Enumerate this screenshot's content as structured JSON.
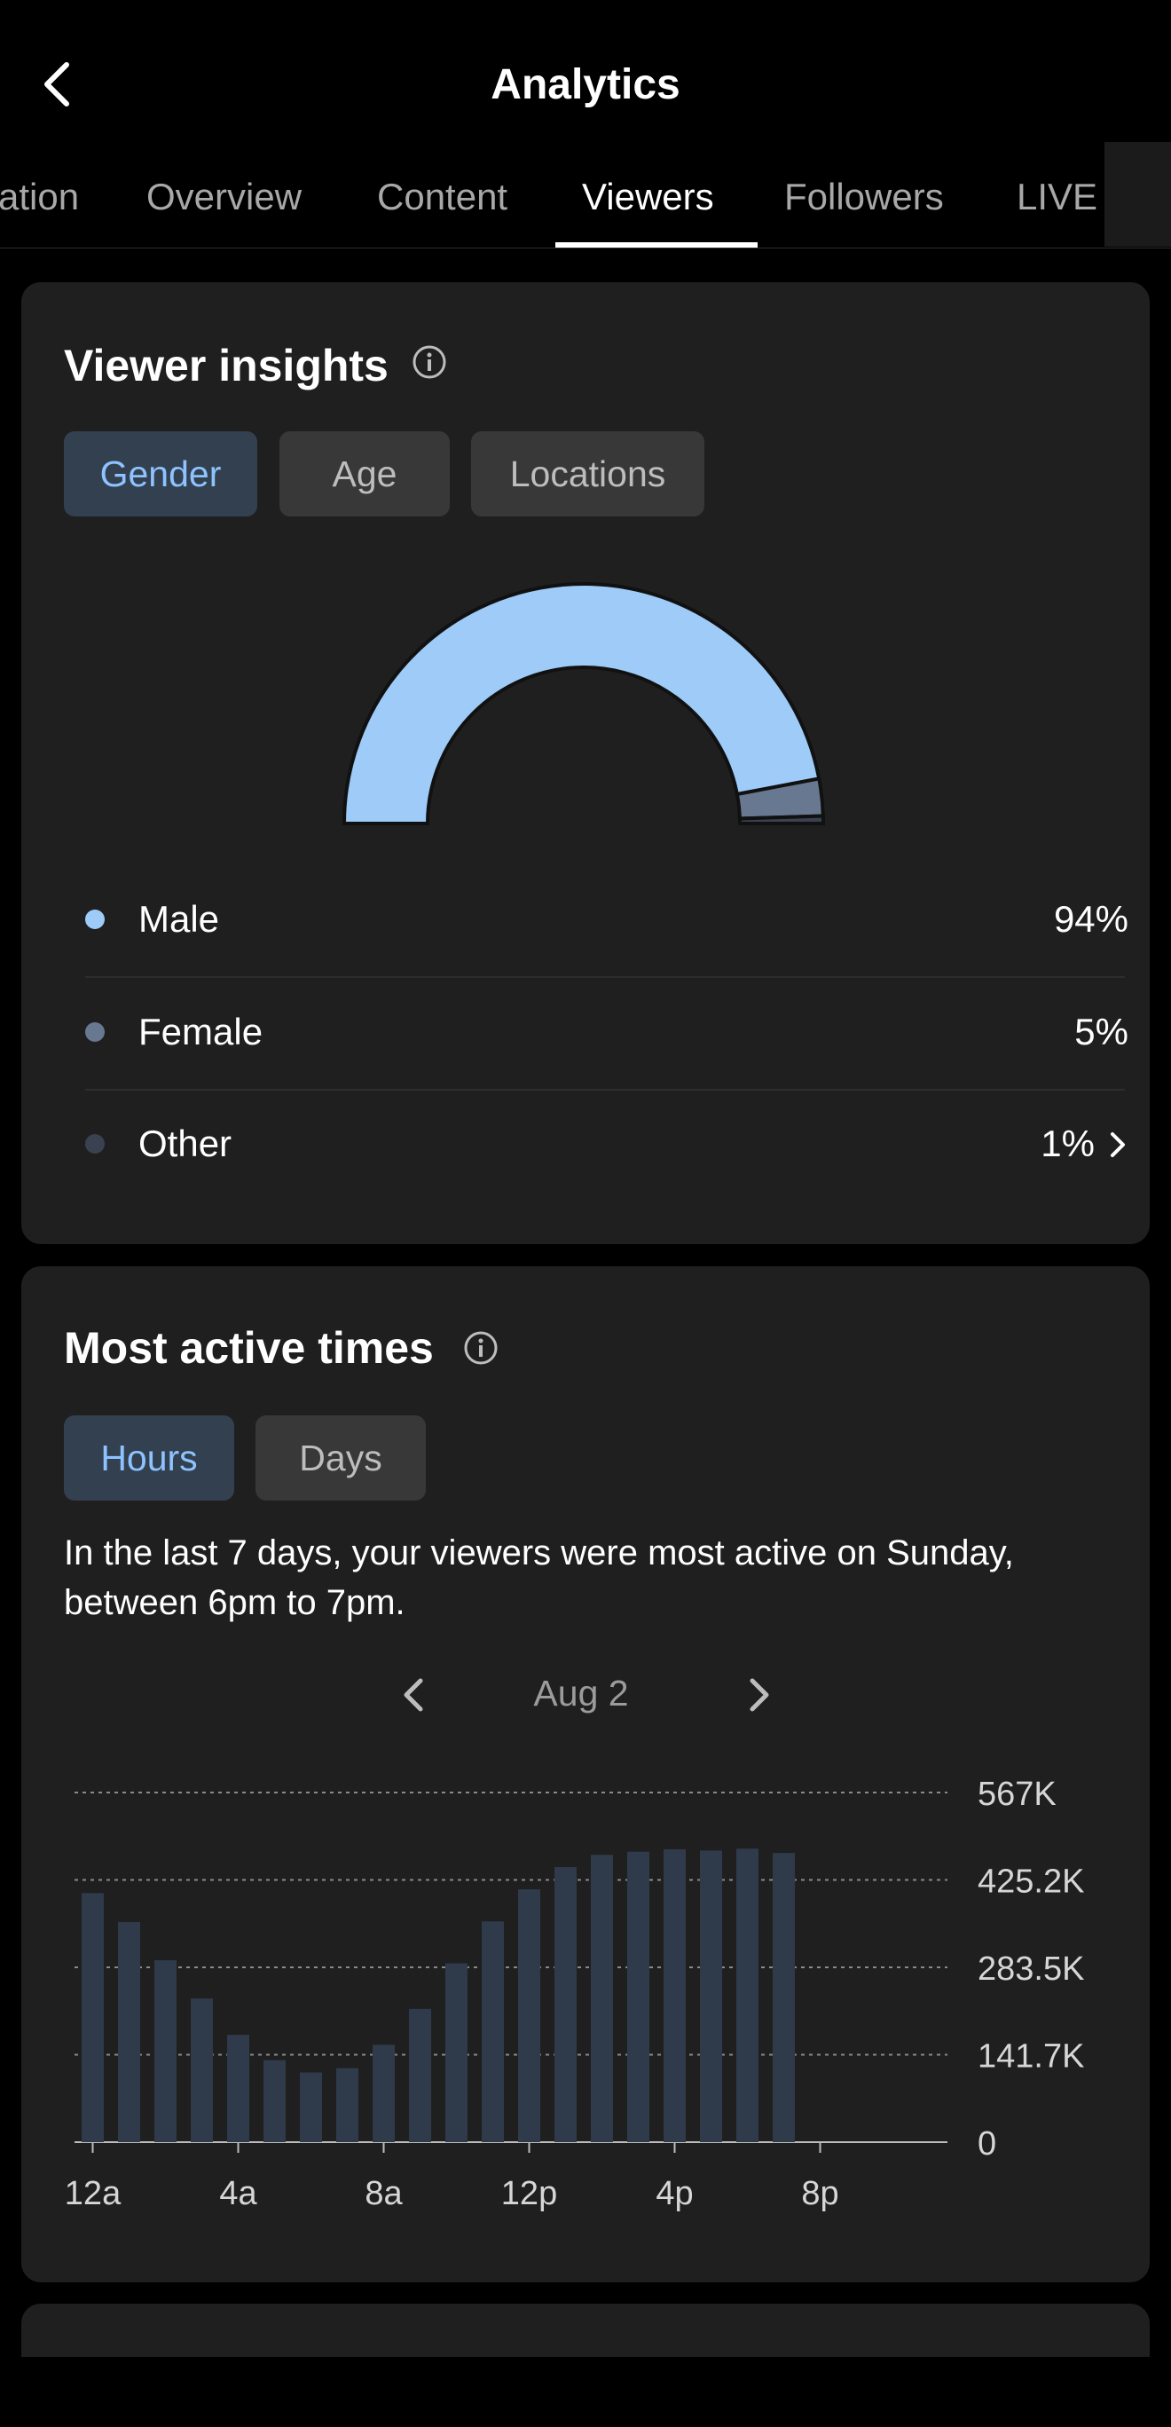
{
  "header": {
    "title": "Analytics"
  },
  "tabs": [
    {
      "label": "ation",
      "active": false
    },
    {
      "label": "Overview",
      "active": false
    },
    {
      "label": "Content",
      "active": false
    },
    {
      "label": "Viewers",
      "active": true
    },
    {
      "label": "Followers",
      "active": false
    },
    {
      "label": "LIVE",
      "active": false
    }
  ],
  "viewer_insights": {
    "title": "Viewer insights",
    "filters": [
      "Gender",
      "Age",
      "Locations"
    ],
    "selected_filter": "Gender",
    "legend": [
      {
        "label": "Male",
        "value": "94%",
        "color": "#9ecbf7"
      },
      {
        "label": "Female",
        "value": "5%",
        "color": "#687891"
      },
      {
        "label": "Other",
        "value": "1%",
        "color": "#3a4150"
      }
    ]
  },
  "active_times": {
    "title": "Most active times",
    "filters": [
      "Hours",
      "Days"
    ],
    "selected_filter": "Hours",
    "description": "In the last 7 days, your viewers were most active on Sunday, between 6pm to 7pm.",
    "date_label": "Aug 2"
  },
  "chart_data": [
    {
      "type": "pie",
      "variant": "semi-donut",
      "categories": [
        "Male",
        "Female",
        "Other"
      ],
      "values": [
        94,
        5,
        1
      ],
      "colors": [
        "#9ecbf7",
        "#687891",
        "#3a4150"
      ]
    },
    {
      "type": "bar",
      "categories": [
        "12a",
        "1a",
        "2a",
        "3a",
        "4a",
        "5a",
        "6a",
        "7a",
        "8a",
        "9a",
        "10a",
        "11a",
        "12p",
        "1p",
        "2p",
        "3p",
        "4p",
        "5p",
        "6p",
        "7p",
        "8p",
        "9p",
        "10p",
        "11p"
      ],
      "values": [
        404000,
        357000,
        295000,
        233000,
        174000,
        133000,
        113000,
        120000,
        158000,
        216000,
        290000,
        358000,
        410000,
        446000,
        466000,
        471000,
        475000,
        473000,
        476000,
        469000,
        null,
        null,
        null,
        null
      ],
      "x_tick_labels": [
        "12a",
        "4a",
        "8a",
        "12p",
        "4p",
        "8p"
      ],
      "y_tick_labels": [
        "0",
        "141.7K",
        "283.5K",
        "425.2K",
        "567K"
      ],
      "ylim": [
        0,
        567000
      ],
      "grid": true,
      "bar_color": "#2f3a4a"
    }
  ]
}
